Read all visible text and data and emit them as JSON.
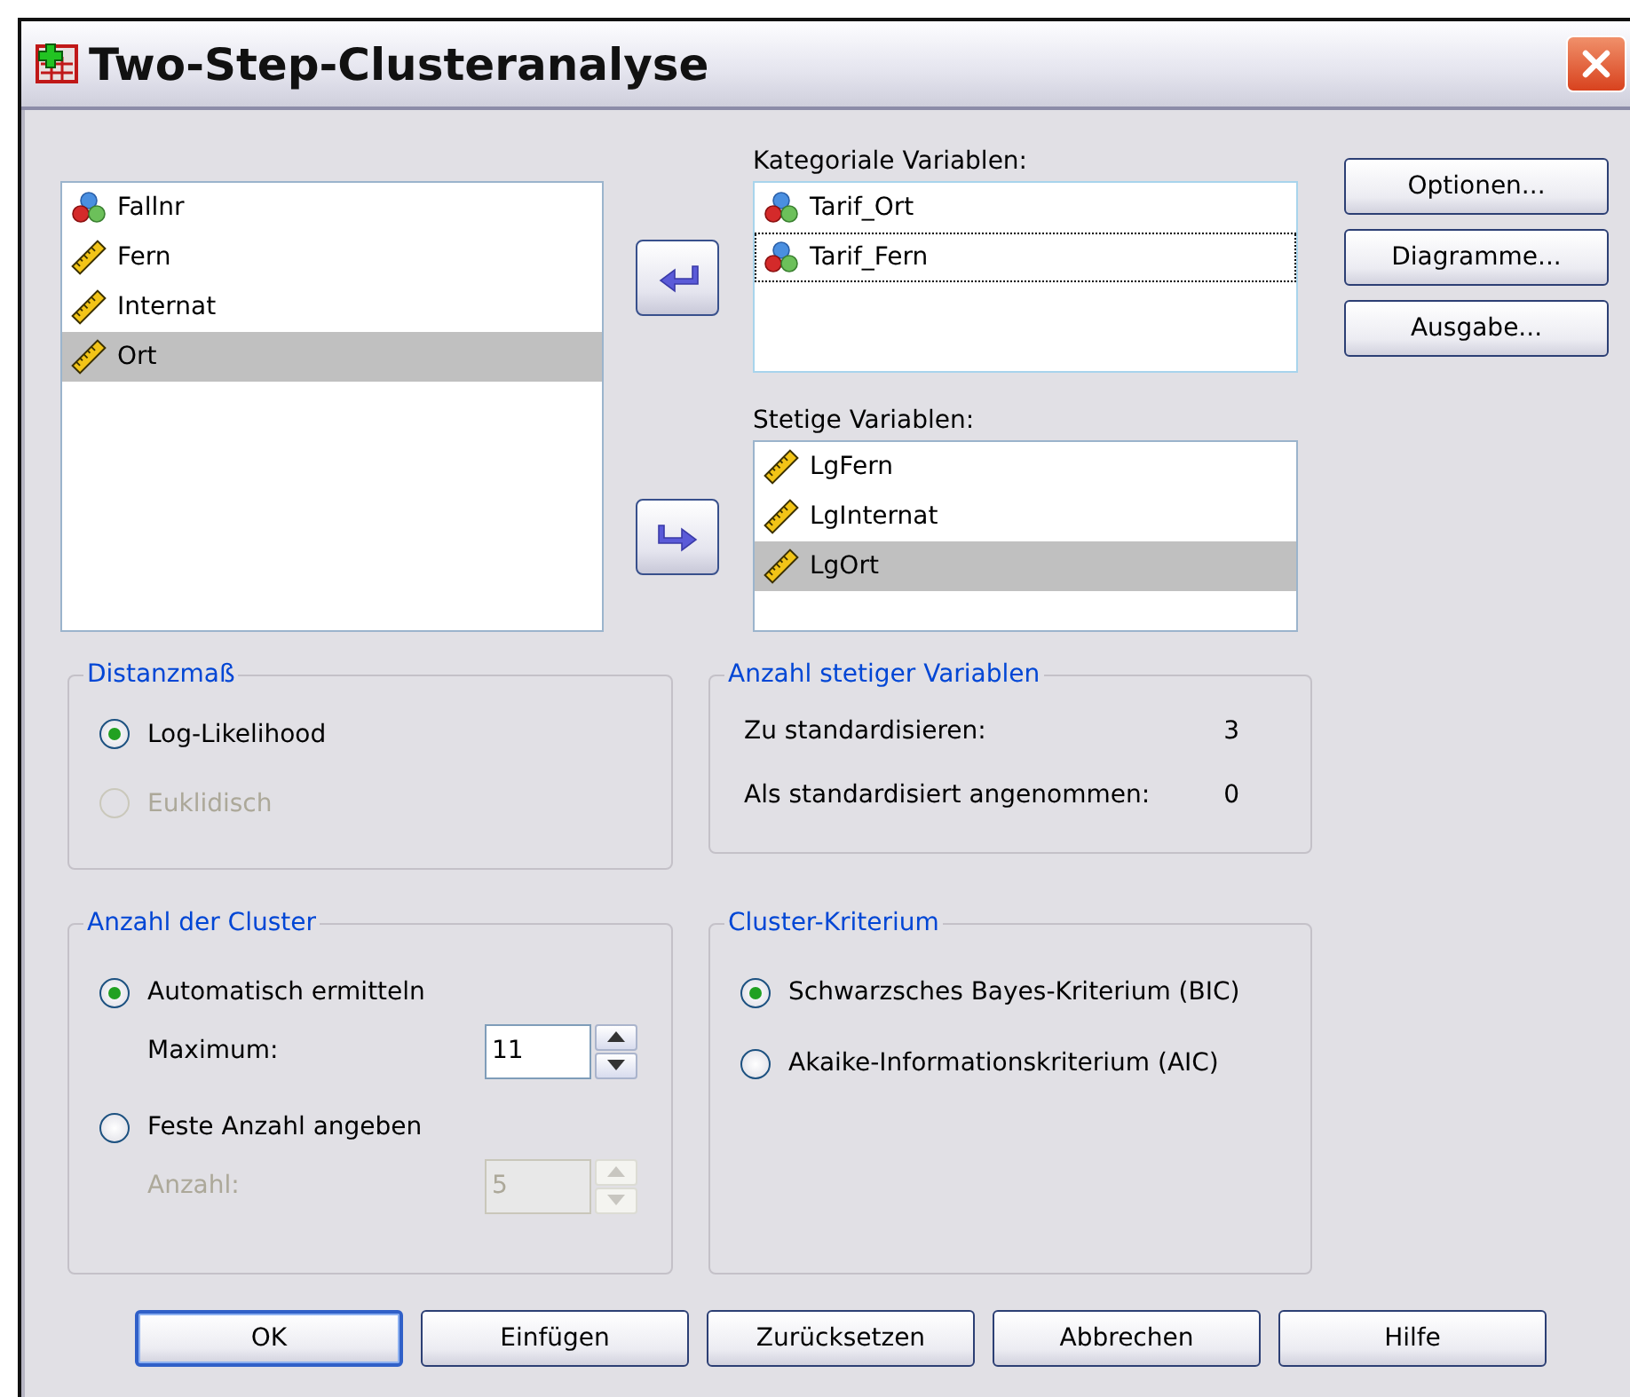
{
  "window": {
    "title": "Two-Step-Clusteranalyse"
  },
  "source_list": {
    "items": [
      {
        "name": "Fallnr",
        "kind": "nominal",
        "selected": false
      },
      {
        "name": "Fern",
        "kind": "scale",
        "selected": false
      },
      {
        "name": "Internat",
        "kind": "scale",
        "selected": false
      },
      {
        "name": "Ort",
        "kind": "scale",
        "selected": true
      }
    ]
  },
  "categorical": {
    "label": "Kategoriale Variablen:",
    "items": [
      {
        "name": "Tarif_Ort",
        "kind": "nominal",
        "selected": false,
        "focused": false
      },
      {
        "name": "Tarif_Fern",
        "kind": "nominal",
        "selected": false,
        "focused": true
      }
    ]
  },
  "continuous": {
    "label": "Stetige Variablen:",
    "items": [
      {
        "name": "LgFern",
        "kind": "scale",
        "selected": false,
        "focused": false
      },
      {
        "name": "LgInternat",
        "kind": "scale",
        "selected": false,
        "focused": false
      },
      {
        "name": "LgOrt",
        "kind": "scale",
        "selected": true,
        "focused": false
      }
    ]
  },
  "side_buttons": [
    "Optionen...",
    "Diagramme...",
    "Ausgabe..."
  ],
  "distance": {
    "title": "Distanzmaß",
    "options": [
      {
        "label": "Log-Likelihood",
        "selected": true,
        "disabled": false
      },
      {
        "label": "Euklidisch",
        "selected": false,
        "disabled": true
      }
    ]
  },
  "continuous_count": {
    "title": "Anzahl stetiger Variablen",
    "rows": [
      {
        "label": "Zu standardisieren:",
        "value": "3"
      },
      {
        "label": "Als standardisiert angenommen:",
        "value": "0"
      }
    ]
  },
  "cluster_count": {
    "title": "Anzahl der Cluster",
    "options": [
      {
        "label": "Automatisch ermitteln",
        "selected": true,
        "disabled": false,
        "field": {
          "label": "Maximum:",
          "value": "11",
          "disabled": false
        }
      },
      {
        "label": "Feste Anzahl angeben",
        "selected": false,
        "disabled": false,
        "field": {
          "label": "Anzahl:",
          "value": "5",
          "disabled": true
        }
      }
    ]
  },
  "criterion": {
    "title": "Cluster-Kriterium",
    "options": [
      {
        "label": "Schwarzsches Bayes-Kriterium (BIC)",
        "selected": true,
        "disabled": false
      },
      {
        "label": "Akaike-Informationskriterium (AIC)",
        "selected": false,
        "disabled": false
      }
    ]
  },
  "buttons": [
    {
      "label": "OK",
      "default": true
    },
    {
      "label": "Einfügen",
      "default": false
    },
    {
      "label": "Zurücksetzen",
      "default": false
    },
    {
      "label": "Abbrechen",
      "default": false
    },
    {
      "label": "Hilfe",
      "default": false
    }
  ]
}
